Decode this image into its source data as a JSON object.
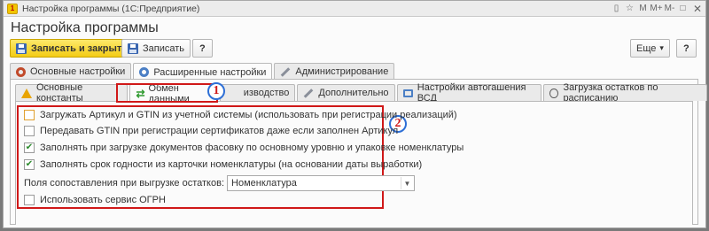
{
  "window": {
    "title": "Настройка программы (1С:Предприятие)",
    "controls": [
      "▯",
      "☆",
      "M",
      "M+",
      "M-",
      "□",
      "✕"
    ]
  },
  "form": {
    "title": "Настройка программы"
  },
  "toolbar": {
    "save_close_label": "Записать и закрыть",
    "save_label": "Записать",
    "help_label": "?",
    "more_label": "Еще",
    "more_arrow": "▾"
  },
  "tabs": [
    {
      "label": "Основные настройки",
      "icon": "gear-icon"
    },
    {
      "label": "Расширенные настройки",
      "icon": "gear-icon",
      "active": true
    },
    {
      "label": "Администрирование",
      "icon": "wrench-icon"
    }
  ],
  "subtabs": [
    {
      "label": "Основные константы",
      "icon": "warning-icon"
    },
    {
      "label": "Обмен данными",
      "icon": "exchange-icon",
      "active": true
    },
    {
      "label": "изводство",
      "icon": ""
    },
    {
      "label": "Дополнительно",
      "icon": "tools-icon"
    },
    {
      "label": "Настройки автогашения ВСД",
      "icon": "monitor-icon"
    },
    {
      "label": "Загрузка остатков по расписанию",
      "icon": "clock-icon"
    }
  ],
  "settings": {
    "load_article_gtin": {
      "label": "Загружать Артикул и GTIN из учетной системы (использовать при регистрации реализаций)",
      "checked": false
    },
    "send_gtin": {
      "label": "Передавать GTIN при регистрации сертификатов даже если заполнен Артикул",
      "checked": false
    },
    "fill_packaging": {
      "label": "Заполнять при загрузке документов фасовку по основному уровню и упаковке номенклатуры",
      "checked": true
    },
    "fill_shelf_life": {
      "label": "Заполнять срок годности из карточки номенклатуры (на основании даты выработки)",
      "checked": true
    },
    "match_fields": {
      "label": "Поля сопоставления при выгрузке остатков:",
      "value": "Номенклатура"
    },
    "use_ogrn": {
      "label": "Использовать сервис ОГРН",
      "checked": false
    }
  },
  "annotations": {
    "badge1": "1",
    "badge2": "2"
  },
  "colors": {
    "highlight": "#d01818",
    "badge_border": "#2e6fd6",
    "primary": "#f3cc16"
  }
}
